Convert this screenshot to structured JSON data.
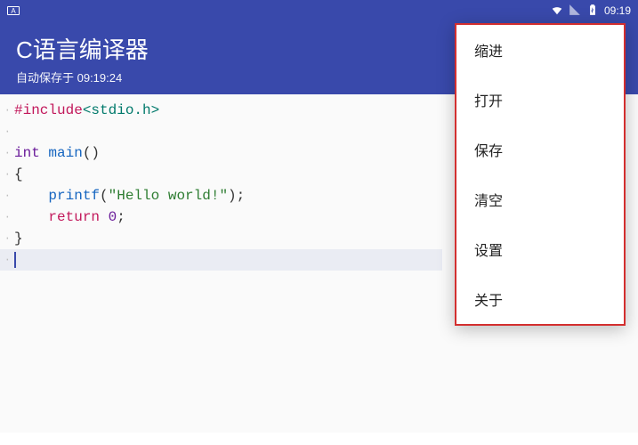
{
  "status_bar": {
    "left_badge": "A",
    "time": "09:19"
  },
  "header": {
    "title": "C语言编译器",
    "subtitle": "自动保存于 09:19:24"
  },
  "code": {
    "lines": [
      {
        "segments": [
          {
            "t": "#include",
            "c": "pre"
          },
          {
            "t": "<stdio.h>",
            "c": "inc"
          }
        ]
      },
      {
        "segments": []
      },
      {
        "segments": [
          {
            "t": "int ",
            "c": "ty"
          },
          {
            "t": "main",
            "c": "fn"
          },
          {
            "t": "()",
            "c": "pl"
          }
        ]
      },
      {
        "segments": [
          {
            "t": "{",
            "c": "pl"
          }
        ]
      },
      {
        "segments": [
          {
            "t": "    ",
            "c": "pl"
          },
          {
            "t": "printf",
            "c": "fn"
          },
          {
            "t": "(",
            "c": "pl"
          },
          {
            "t": "\"Hello world!\"",
            "c": "str"
          },
          {
            "t": ");",
            "c": "pl"
          }
        ]
      },
      {
        "segments": [
          {
            "t": "    ",
            "c": "pl"
          },
          {
            "t": "return ",
            "c": "kw"
          },
          {
            "t": "0",
            "c": "num"
          },
          {
            "t": ";",
            "c": "pl"
          }
        ]
      },
      {
        "segments": [
          {
            "t": "}",
            "c": "pl"
          }
        ]
      },
      {
        "segments": [],
        "cursor": true
      }
    ]
  },
  "menu": {
    "items": [
      {
        "label": "缩进",
        "name": "menu-item-indent"
      },
      {
        "label": "打开",
        "name": "menu-item-open"
      },
      {
        "label": "保存",
        "name": "menu-item-save"
      },
      {
        "label": "清空",
        "name": "menu-item-clear"
      },
      {
        "label": "设置",
        "name": "menu-item-settings"
      },
      {
        "label": "关于",
        "name": "menu-item-about"
      }
    ]
  }
}
